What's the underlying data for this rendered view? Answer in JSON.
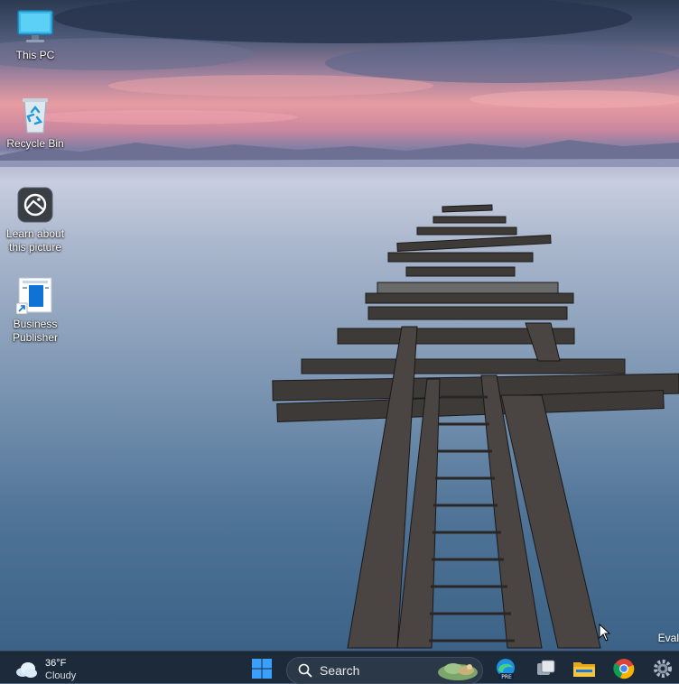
{
  "desktop": {
    "icons": [
      {
        "label": "This PC",
        "icon": "monitor-icon"
      },
      {
        "label": "Recycle Bin",
        "icon": "recycle-bin-icon"
      },
      {
        "label": "Learn about this picture",
        "icon": "camera-info-icon"
      },
      {
        "label": "Business Publisher",
        "icon": "publisher-shortcut-icon"
      }
    ],
    "watermark_partial": "Eval"
  },
  "taskbar": {
    "weather": {
      "temperature": "36°F",
      "condition": "Cloudy",
      "icon": "cloud-icon"
    },
    "start_icon": "windows-start-icon",
    "search": {
      "placeholder": "Search",
      "icon": "search-icon"
    },
    "apps": [
      {
        "name": "edge-beta-icon",
        "badge": "PRE"
      },
      {
        "name": "task-view-icon"
      },
      {
        "name": "file-explorer-icon"
      },
      {
        "name": "chrome-icon"
      },
      {
        "name": "settings-icon"
      }
    ]
  },
  "colors": {
    "taskbar_bg": "#1c2a3a",
    "windows_blue": "#1e90ff",
    "folder_yellow": "#f5c542"
  }
}
